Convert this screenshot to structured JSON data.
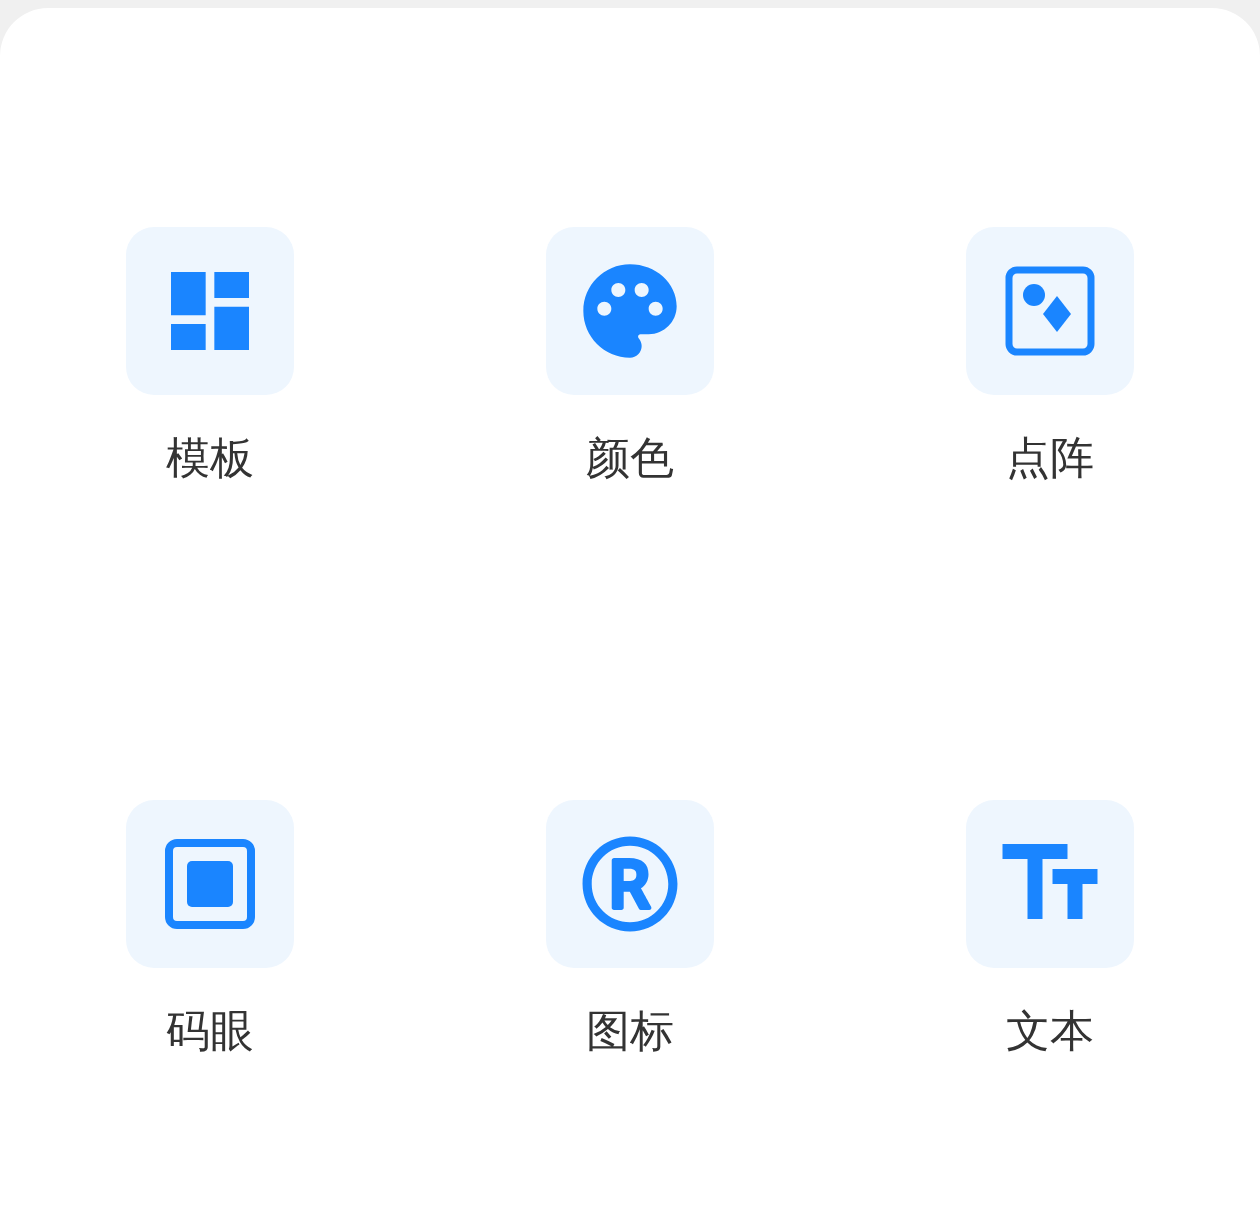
{
  "items": [
    {
      "label": "模板",
      "kind": "layout"
    },
    {
      "label": "颜色",
      "kind": "palette"
    },
    {
      "label": "点阵",
      "kind": "sparkle-image"
    },
    {
      "label": "码眼",
      "kind": "square"
    },
    {
      "label": "图标",
      "kind": "registered"
    },
    {
      "label": "文本",
      "kind": "text"
    }
  ]
}
